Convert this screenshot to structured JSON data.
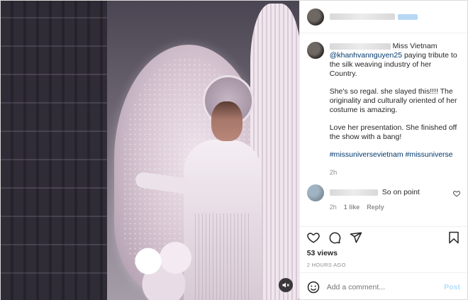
{
  "header": {
    "username_hidden": true
  },
  "caption": {
    "title_suffix": "Miss Vietnam",
    "mention": "@khanhvannguyen25",
    "line1_rest": "paying tribute to the silk weaving industry of her Country.",
    "para2": "She's so regal. she slayed this!!!! The originality and culturally oriented of her costume is amazing.",
    "para3": "Love her presentation. She finished off the show with a bang!",
    "hashtags": "#missuniversevietnam #missuniverse",
    "age": "2h"
  },
  "reply": {
    "text": "So on point",
    "age": "2h",
    "likes": "1 like",
    "reply_label": "Reply"
  },
  "stats": {
    "views": "53 views",
    "time": "2 HOURS AGO"
  },
  "add_comment": {
    "placeholder": "Add a comment...",
    "post_label": "Post"
  },
  "colors": {
    "link": "#00376b",
    "post_disabled": "#b2dffc"
  }
}
